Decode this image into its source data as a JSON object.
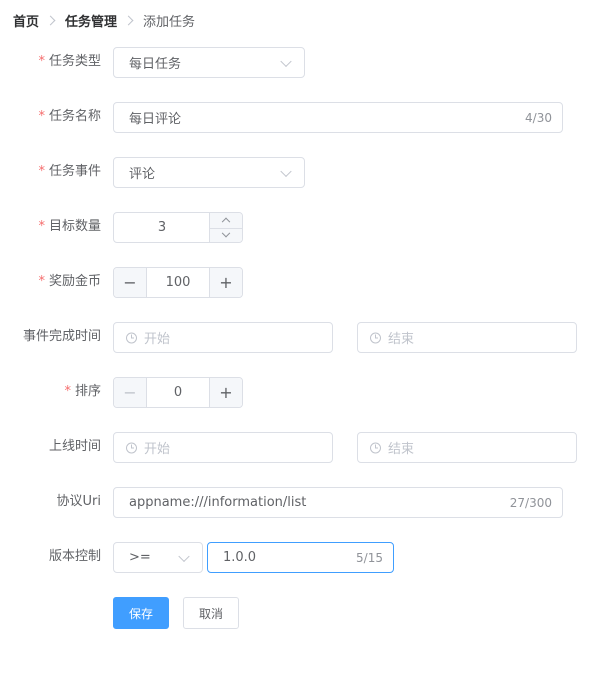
{
  "breadcrumb": {
    "home": "首页",
    "section": "任务管理",
    "current": "添加任务"
  },
  "form": {
    "task_type": {
      "label": "任务类型",
      "value": "每日任务"
    },
    "task_name": {
      "label": "任务名称",
      "value": "每日评论",
      "count": "4/30"
    },
    "task_event": {
      "label": "任务事件",
      "value": "评论"
    },
    "target_count": {
      "label": "目标数量",
      "value": "3"
    },
    "reward_coins": {
      "label": "奖励金币",
      "value": "100",
      "minus": "−",
      "plus": "+"
    },
    "event_time": {
      "label": "事件完成时间",
      "start_placeholder": "开始",
      "end_placeholder": "结束"
    },
    "sort": {
      "label": "排序",
      "value": "0",
      "minus": "−",
      "plus": "+"
    },
    "online_time": {
      "label": "上线时间",
      "start_placeholder": "开始",
      "end_placeholder": "结束"
    },
    "protocol_uri": {
      "label": "协议Uri",
      "value": "appname:///information/list",
      "count": "27/300"
    },
    "version": {
      "label": "版本控制",
      "operator": ">=",
      "value": "1.0.0",
      "count": "5/15"
    }
  },
  "actions": {
    "save": "保存",
    "cancel": "取消"
  },
  "colors": {
    "primary": "#409eff",
    "required": "#f56c6c",
    "border": "#dcdfe6"
  }
}
